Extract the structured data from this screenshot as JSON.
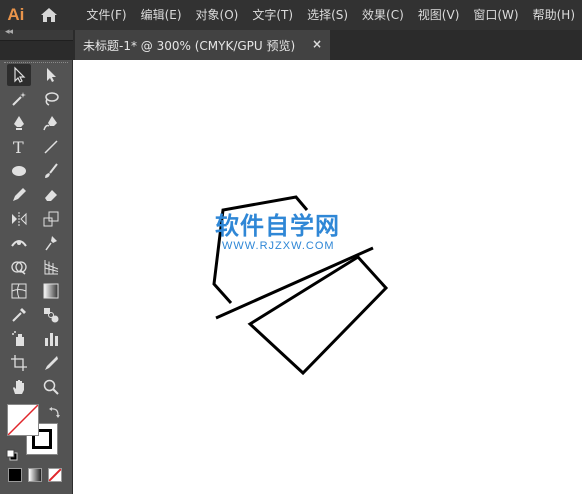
{
  "app": {
    "logo": "Ai",
    "accent": "#e9944b"
  },
  "menu": [
    {
      "label": "文件(F)"
    },
    {
      "label": "编辑(E)"
    },
    {
      "label": "对象(O)"
    },
    {
      "label": "文字(T)"
    },
    {
      "label": "选择(S)"
    },
    {
      "label": "效果(C)"
    },
    {
      "label": "视图(V)"
    },
    {
      "label": "窗口(W)"
    },
    {
      "label": "帮助(H)"
    }
  ],
  "panel": {
    "collapse_glyph": "◂◂"
  },
  "document_tab": {
    "title": "未标题-1* @ 300% (CMYK/GPU 预览)",
    "close": "×"
  },
  "watermark": {
    "title": "软件自学网",
    "subtitle": "WWW.RJZXW.COM",
    "color": "#2f87d6"
  },
  "tools": [
    "selection-tool",
    "direct-selection-tool",
    "magic-wand-tool",
    "lasso-tool",
    "pen-tool",
    "curvature-tool",
    "type-tool",
    "line-segment-tool",
    "ellipse-tool",
    "paintbrush-tool",
    "pencil-tool",
    "eraser-tool",
    "reflect-tool",
    "scale-tool",
    "width-tool",
    "puppet-warp-tool",
    "shape-builder-tool",
    "perspective-grid-tool",
    "mesh-tool",
    "gradient-tool",
    "eyedropper-tool",
    "blend-tool",
    "symbol-sprayer-tool",
    "column-graph-tool",
    "artboard-tool",
    "slice-tool",
    "hand-tool",
    "zoom-tool"
  ],
  "colors": {
    "fill": "#ffffff",
    "stroke": "#000000",
    "none_slash": "#e0262b"
  }
}
